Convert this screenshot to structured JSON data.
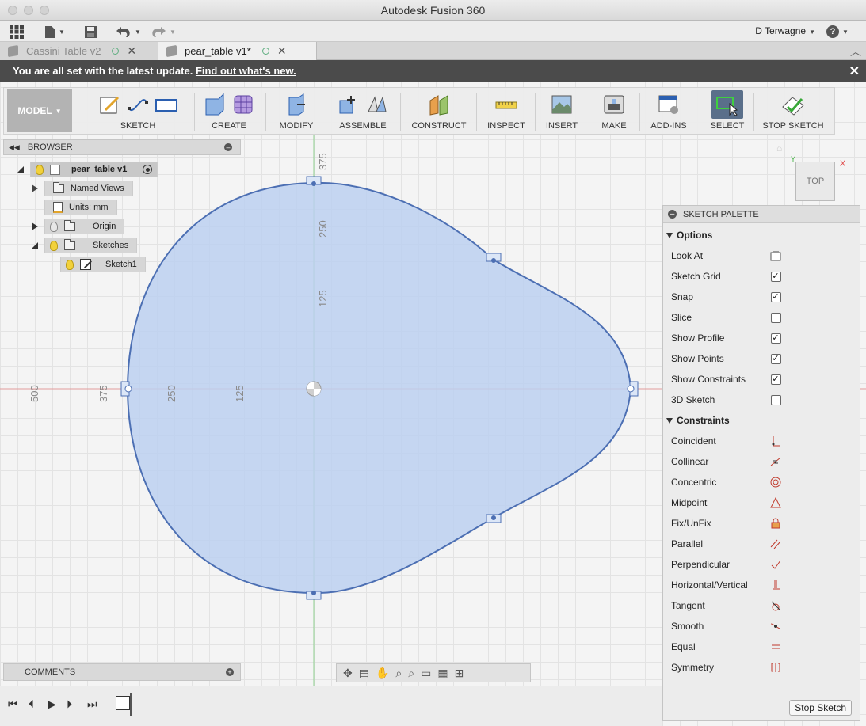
{
  "window": {
    "title": "Autodesk Fusion 360"
  },
  "toolbar": {
    "user": "D Terwagne",
    "help": "?"
  },
  "tabs": [
    {
      "label": "Cassini Table v2",
      "active": false
    },
    {
      "label": "pear_table v1*",
      "active": true
    }
  ],
  "banner": {
    "text": "You are all set with the latest update.",
    "link": "Find out what's new."
  },
  "ribbon": {
    "workspace": "MODEL",
    "groups": [
      "SKETCH",
      "CREATE",
      "MODIFY",
      "ASSEMBLE",
      "CONSTRUCT",
      "INSPECT",
      "INSERT",
      "MAKE",
      "ADD-INS",
      "SELECT",
      "STOP SKETCH"
    ]
  },
  "browser": {
    "header": "BROWSER",
    "root": "pear_table v1",
    "items": [
      {
        "label": "Named Views"
      },
      {
        "label": "Units: mm"
      },
      {
        "label": "Origin"
      },
      {
        "label": "Sketches"
      },
      {
        "label": "Sketch1"
      }
    ]
  },
  "canvas": {
    "axis_labels_v": [
      "375",
      "250",
      "125"
    ],
    "axis_labels_h": [
      "500",
      "375",
      "250",
      "125"
    ],
    "profile_color": "#bcd0f0",
    "outline_color": "#4c6fb3"
  },
  "viewcube": {
    "label": "TOP",
    "x": "X",
    "y": "Y"
  },
  "palette": {
    "title": "SKETCH PALETTE",
    "options_header": "Options",
    "options": [
      {
        "label": "Look At",
        "type": "button"
      },
      {
        "label": "Sketch Grid",
        "checked": true
      },
      {
        "label": "Snap",
        "checked": true
      },
      {
        "label": "Slice",
        "checked": false
      },
      {
        "label": "Show Profile",
        "checked": true
      },
      {
        "label": "Show Points",
        "checked": true
      },
      {
        "label": "Show Constraints",
        "checked": true
      },
      {
        "label": "3D Sketch",
        "checked": false
      }
    ],
    "constraints_header": "Constraints",
    "constraints": [
      "Coincident",
      "Collinear",
      "Concentric",
      "Midpoint",
      "Fix/UnFix",
      "Parallel",
      "Perpendicular",
      "Horizontal/Vertical",
      "Tangent",
      "Smooth",
      "Equal",
      "Symmetry"
    ],
    "stop_button": "Stop Sketch"
  },
  "comments": {
    "label": "COMMENTS"
  }
}
